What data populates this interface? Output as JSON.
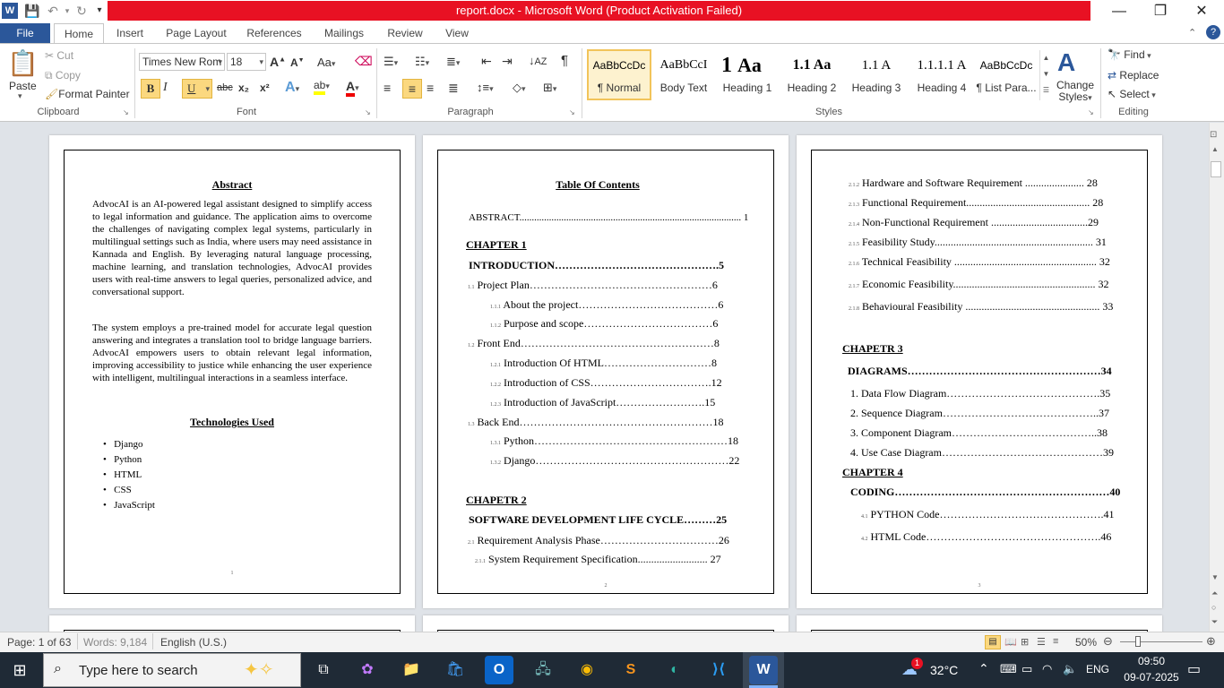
{
  "window": {
    "title": "report.docx - Microsoft Word (Product Activation Failed)"
  },
  "tabs": [
    "File",
    "Home",
    "Insert",
    "Page Layout",
    "References",
    "Mailings",
    "Review",
    "View"
  ],
  "clipboard": {
    "paste": "Paste",
    "cut": "Cut",
    "copy": "Copy",
    "format_painter": "Format Painter",
    "label": "Clipboard"
  },
  "font": {
    "name": "Times New Rom",
    "size": "18",
    "label": "Font",
    "bold": "B",
    "italic": "I",
    "underline": "U",
    "strike": "abc",
    "sub": "x₂",
    "sup": "x²"
  },
  "paragraph": {
    "label": "Paragraph"
  },
  "styles": {
    "label": "Styles",
    "items": [
      {
        "preview": "AaBbCcDc",
        "name": "¶ Normal"
      },
      {
        "preview": "AaBbCcI",
        "name": "Body Text"
      },
      {
        "preview": "1",
        "name": "Heading 1"
      },
      {
        "preview": "Aa",
        "name": "Heading 2"
      },
      {
        "preview": "1.1",
        "name": "Heading 3"
      },
      {
        "preview": "Aa",
        "name": "Heading 4"
      },
      {
        "preview": "1.1  A",
        "name": "¶ List Para..."
      },
      {
        "preview": "1.1.1  A",
        "name": ""
      },
      {
        "preview": "1.1.1.1  A",
        "name": ""
      },
      {
        "preview": "AaBbCcDc",
        "name": ""
      }
    ],
    "change_styles": "Change Styles"
  },
  "editing": {
    "label": "Editing",
    "find": "Find",
    "replace": "Replace",
    "select": "Select"
  },
  "page1": {
    "title": "Abstract",
    "p1": "AdvocAI is an AI-powered legal assistant designed to simplify access to legal information and guidance. The application aims to overcome the challenges of navigating complex legal systems, particularly in multilingual settings such as India, where users may need assistance in Kannada and English. By leveraging natural language processing, machine learning, and translation technologies, AdvocAI provides users with real-time answers to legal queries, personalized advice, and conversational support.",
    "p2": "The system employs a pre-trained model for accurate legal question answering and integrates a translation tool to bridge language barriers. AdvocAI empowers users to obtain relevant legal information, improving accessibility to justice while enhancing the user experience with intelligent, multilingual interactions in a seamless interface.",
    "tech_title": "Technologies Used",
    "tech": [
      "Django",
      "Python",
      "HTML",
      "CSS",
      "JavaScript"
    ],
    "page_no": "1"
  },
  "page2": {
    "title": "Table Of Contents",
    "lines": [
      {
        "num": "",
        "text": "ABSTRACT.......................................................................................... 1"
      },
      {
        "num": "",
        "text": "CHAPTER 1"
      },
      {
        "num": "",
        "text": "INTRODUCTION……………………………………….5"
      },
      {
        "num": "1.1",
        "text": "Project Plan……………………………………………6"
      },
      {
        "num": "1.1.1",
        "text": "About the project…………………………………6"
      },
      {
        "num": "1.1.2",
        "text": "Purpose and scope………………………………6"
      },
      {
        "num": "1.2",
        "text": "Front End………………………………………………8"
      },
      {
        "num": "1.2.1",
        "text": "Introduction Of HTML…………………………8"
      },
      {
        "num": "1.2.2",
        "text": "Introduction of CSS…………………………….12"
      },
      {
        "num": "1.2.3",
        "text": "Introduction of JavaScript…………………….15"
      },
      {
        "num": "1.3",
        "text": "Back End………………………………………………18"
      },
      {
        "num": "1.3.1",
        "text": "Python………………………………………………18"
      },
      {
        "num": "1.3.2",
        "text": "Django………………………………………………22"
      },
      {
        "num": "",
        "text": "CHAPETR 2"
      },
      {
        "num": "",
        "text": "SOFTWARE DEVELOPMENT LIFE CYCLE………25"
      },
      {
        "num": "2.1",
        "text": "Requirement Analysis Phase……………………………26"
      },
      {
        "num": "2.1.1",
        "text": "System Requirement Specification.......................... 27"
      }
    ],
    "page_no": "2"
  },
  "page3": {
    "lines": [
      {
        "num": "2.1.2",
        "text": "Hardware and Software Requirement ...................... 28"
      },
      {
        "num": "2.1.3",
        "text": "Functional Requirement.............................................. 28"
      },
      {
        "num": "2.1.4",
        "text": "Non-Functional Requirement ....................................29"
      },
      {
        "num": "2.1.5",
        "text": "Feasibility Study........................................................... 31"
      },
      {
        "num": "2.1.6",
        "text": "Technical Feasibility ..................................................... 32"
      },
      {
        "num": "2.1.7",
        "text": "Economic Feasibility..................................................... 32"
      },
      {
        "num": "2.1.8",
        "text": "Behavioural Feasibility .................................................. 33"
      },
      {
        "num": "",
        "text": "CHAPETR 3"
      },
      {
        "num": "",
        "text": "DIAGRAMS………………………………………………34"
      },
      {
        "num": "",
        "text": "1.  Data Flow Diagram…………………………………….35"
      },
      {
        "num": "",
        "text": "2.  Sequence Diagram……………………………………..37"
      },
      {
        "num": "",
        "text": "3.  Component Diagram…………………………………..38"
      },
      {
        "num": "",
        "text": "4.  Use Case Diagram………………………………………39"
      },
      {
        "num": "",
        "text": "CHAPTER 4"
      },
      {
        "num": "",
        "text": "CODING……………………………………………………40"
      },
      {
        "num": "4.1",
        "text": "PYTHON Code……………………………………….41"
      },
      {
        "num": "4.2",
        "text": "HTML Code………………………………………….46"
      }
    ],
    "page_no": "3"
  },
  "status": {
    "page": "Page: 1 of 63",
    "words": "Words: 9,184",
    "lang": "English (U.S.)",
    "zoom": "50%"
  },
  "taskbar": {
    "search": "Type here to search",
    "temp": "32°C",
    "lang": "ENG",
    "time": "09:50",
    "date": "09-07-2025",
    "notif": "1"
  }
}
